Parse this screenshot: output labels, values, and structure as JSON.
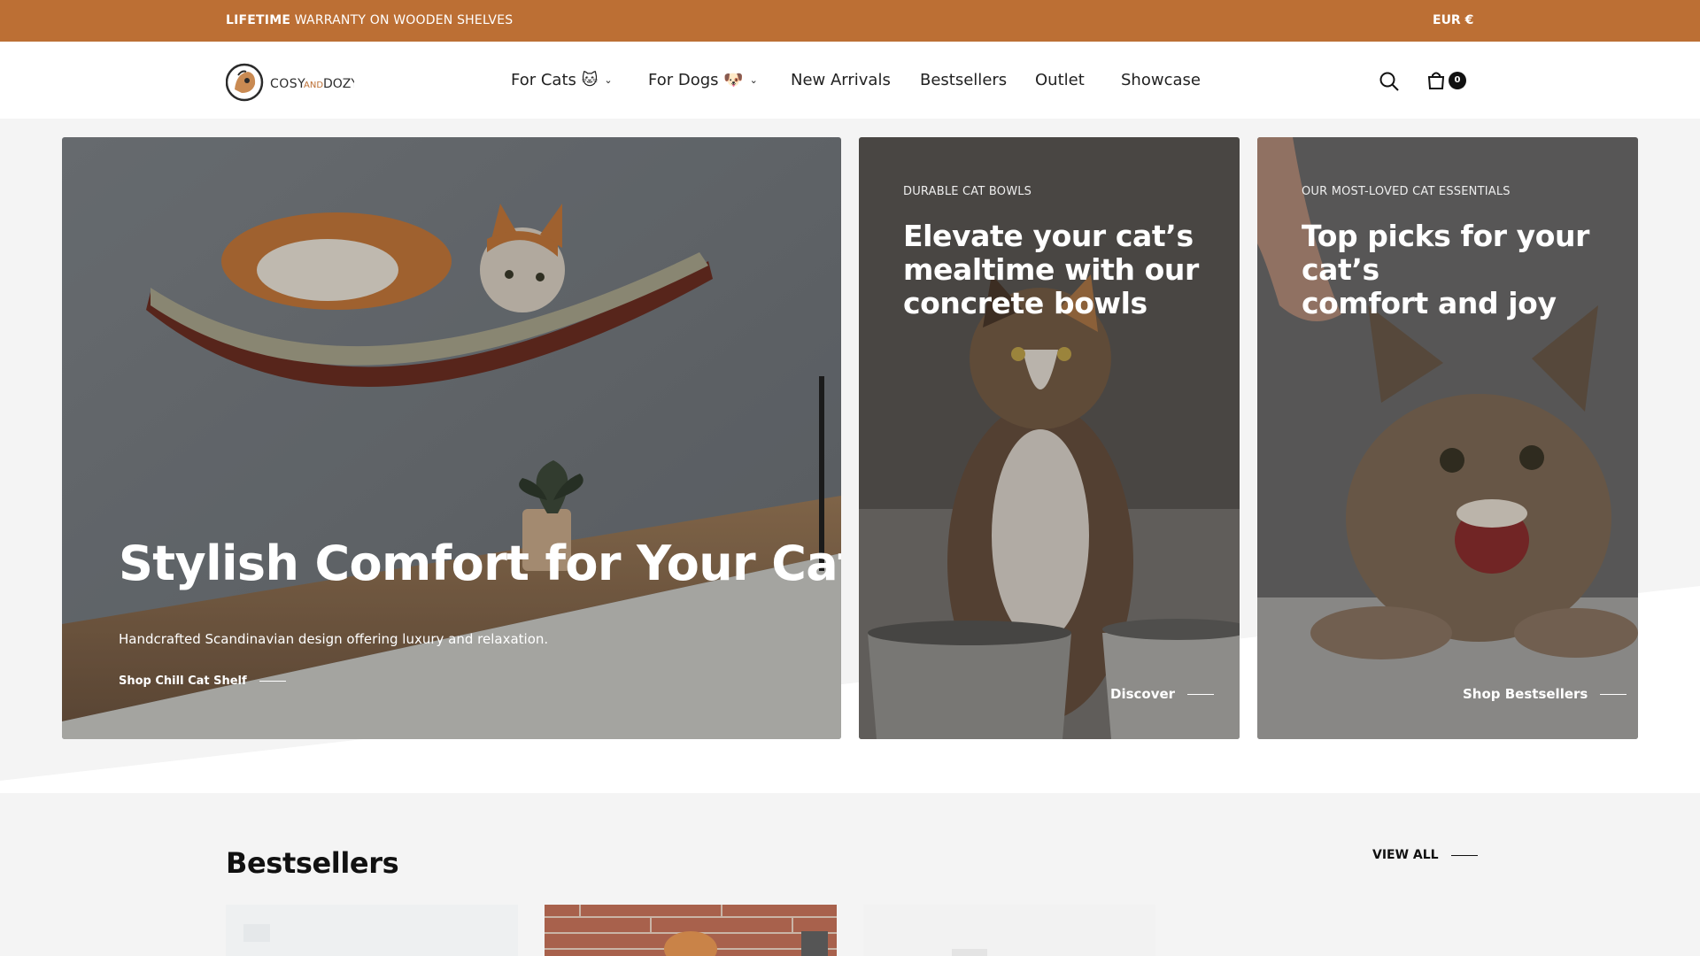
{
  "announcement": {
    "bold": "LIFETIME",
    "text": " WARRANTY ON WOODEN SHELVES",
    "currency": "EUR  €"
  },
  "header": {
    "logo_text": "COSYANDDOZY",
    "nav": [
      {
        "label": "For Cats 🐱",
        "dropdown": true
      },
      {
        "label": "For Dogs 🐶",
        "dropdown": true
      },
      {
        "label": "New Arrivals"
      },
      {
        "label": "Bestsellers"
      },
      {
        "label": "Outlet"
      },
      {
        "label": "Showcase"
      }
    ],
    "cart_count": "0",
    "icons": {
      "search": "search-icon",
      "cart": "cart-icon"
    }
  },
  "hero": {
    "main": {
      "title": "Stylish Comfort for Your Cat",
      "subtitle": "Handcrafted Scandinavian design offering luxury and relaxation.",
      "cta": "Shop Chill Cat Shelf"
    },
    "card2": {
      "eyebrow": "DURABLE CAT BOWLS",
      "line1": "Elevate your cat’s",
      "line2": "mealtime with our",
      "line3": "concrete bowls",
      "cta": "Discover"
    },
    "card3": {
      "eyebrow": "OUR MOST-LOVED CAT ESSENTIALS",
      "line1": "Top picks for your cat’s",
      "line2": "comfort and joy",
      "cta": "Shop Bestsellers"
    }
  },
  "bestsellers": {
    "title": "Bestsellers",
    "view_all": "VIEW ALL"
  },
  "colors": {
    "brand": "#bc6f34",
    "ink": "#111111"
  }
}
